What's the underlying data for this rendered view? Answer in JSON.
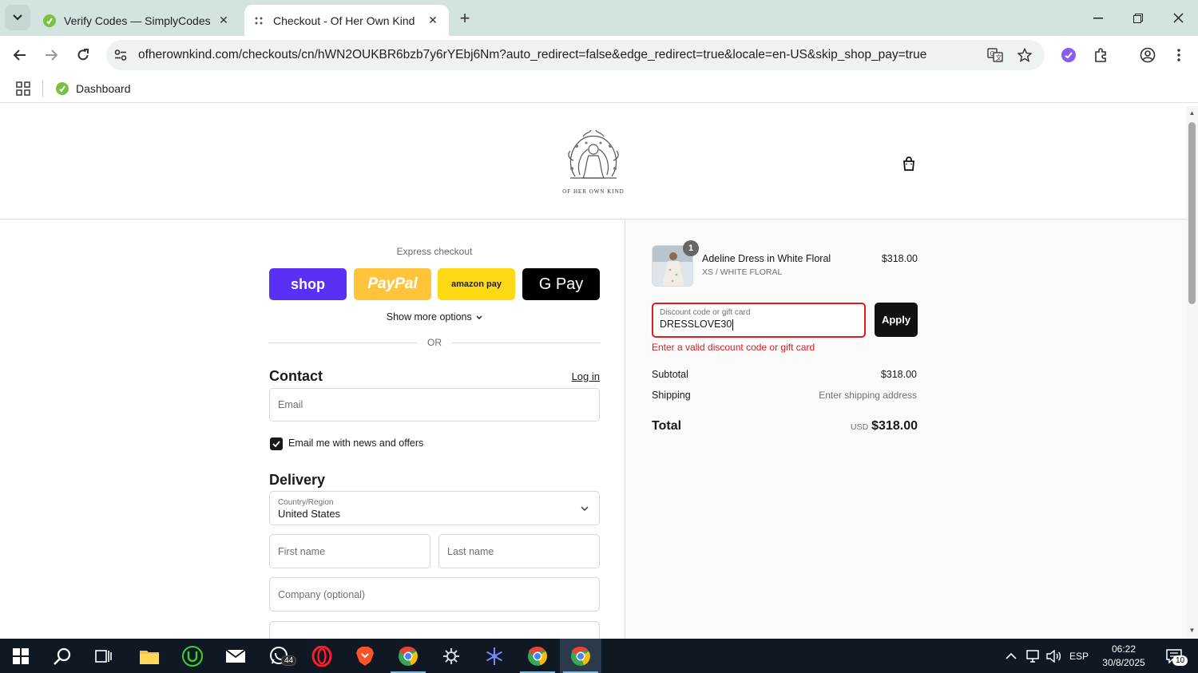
{
  "browser": {
    "tabs": [
      {
        "title": "Verify Codes — SimplyCodes",
        "active": false
      },
      {
        "title": "Checkout - Of Her Own Kind",
        "active": true
      }
    ],
    "url_host": "ofherownkind.com",
    "url_rest": "/checkouts/cn/hWN2OUKBR6bzb7y6rYEbj6Nm?auto_redirect=false&edge_redirect=true&locale=en-US&skip_shop_pay=true",
    "bookmarks": [
      {
        "label": "Dashboard"
      }
    ]
  },
  "store": {
    "logo_text": "OF HER OWN KIND"
  },
  "checkout": {
    "express_title": "Express checkout",
    "pay_buttons": [
      "shop",
      "PayPal",
      "amazon pay",
      "G Pay"
    ],
    "more_options": "Show more options",
    "or": "OR",
    "contact_title": "Contact",
    "login_label": "Log in",
    "email_placeholder": "Email",
    "newsletter_label": "Email me with news and offers",
    "newsletter_checked": true,
    "delivery_title": "Delivery",
    "country_label": "Country/Region",
    "country_value": "United States",
    "first_name_placeholder": "First name",
    "last_name_placeholder": "Last name",
    "company_placeholder": "Company (optional)"
  },
  "summary": {
    "item": {
      "quantity": "1",
      "name": "Adeline Dress in White Floral",
      "variant": "XS / WHITE FLORAL",
      "price": "$318.00"
    },
    "discount_label": "Discount code or gift card",
    "discount_value": "DRESSLOVE30",
    "apply_label": "Apply",
    "discount_error": "Enter a valid discount code or gift card",
    "subtotal_label": "Subtotal",
    "subtotal_value": "$318.00",
    "shipping_label": "Shipping",
    "shipping_value": "Enter shipping address",
    "total_label": "Total",
    "total_currency": "USD",
    "total_value": "$318.00"
  },
  "taskbar": {
    "whatsapp_badge": "44",
    "language": "ESP",
    "time": "06:22",
    "date": "30/8/2025",
    "notifications": "10"
  },
  "colors": {
    "shop_pay": "#5a31f4",
    "paypal": "#ffc439",
    "amazon_pay": "#ffd814",
    "gpay": "#000000",
    "error": "#dd1d1d"
  }
}
